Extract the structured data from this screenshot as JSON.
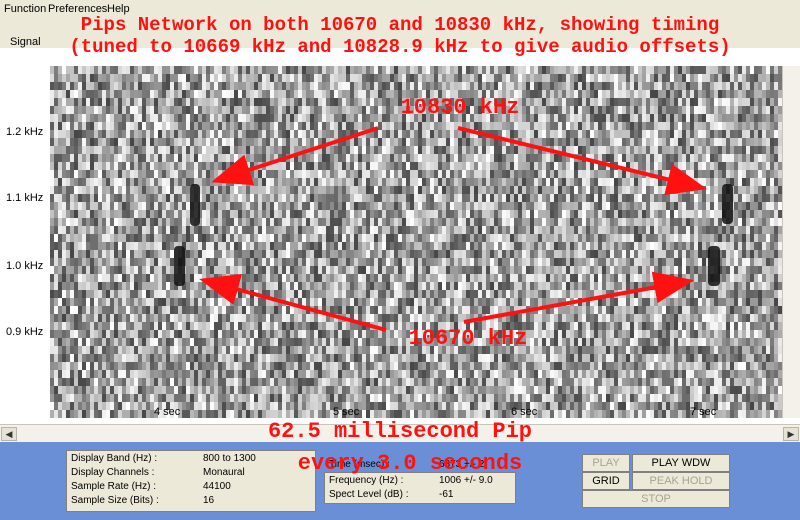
{
  "menu": [
    "Function",
    "Preferences",
    "Help"
  ],
  "signal_label": "Signal",
  "annotations": {
    "title_line1": "Pips Network on both 10670 and 10830 kHz, showing timing",
    "title_line2": "(tuned to 10669 kHz and 10828.9 kHz to give audio offsets)",
    "label_10830": "10830 kHz",
    "label_10670": "10670 kHz",
    "bottom_line1": "62.5 millisecond Pip",
    "bottom_line2": "every 3.0 seconds",
    "color": "#ff1111"
  },
  "y_axis_labels": [
    "1.2 kHz",
    "1.1 kHz",
    "1.0 kHz",
    "0.9 kHz"
  ],
  "x_axis_labels": [
    "4  sec",
    "5  sec",
    "6  sec",
    "7  sec"
  ],
  "info_left": {
    "rows": [
      {
        "k": "Display Band (Hz) :",
        "v": "800 to 1300"
      },
      {
        "k": "Display Channels :",
        "v": "Monaural"
      },
      {
        "k": "Sample Rate (Hz) :",
        "v": "44100"
      },
      {
        "k": "Sample Size (Bits) :",
        "v": "16"
      }
    ]
  },
  "info_right": {
    "rows": [
      {
        "k": "Time (msec) :",
        "v": "6873 +/- 2"
      },
      {
        "k": "Frequency (Hz) :",
        "v": "1006 +/- 9.0"
      },
      {
        "k": "Spect Level (dB) :",
        "v": "-61"
      }
    ]
  },
  "buttons": {
    "play": "PLAY",
    "play_wdw": "PLAY WDW",
    "grid": "GRID",
    "peak_hold": "PEAK HOLD",
    "stop": "STOP"
  },
  "colors": {
    "panel_bg": "#6b8fd6",
    "window_bg": "#ece9d8"
  }
}
